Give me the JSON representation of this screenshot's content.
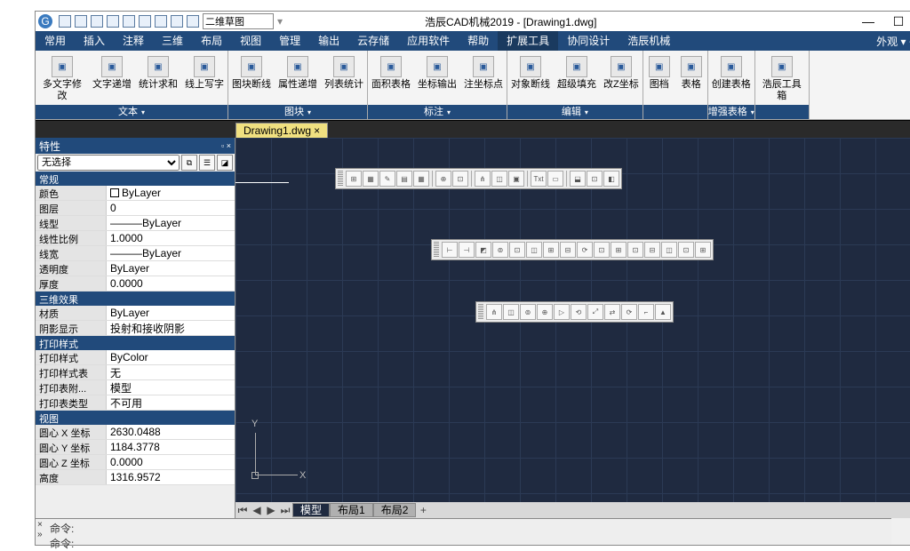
{
  "title": "浩辰CAD机械2019 - [Drawing1.dwg]",
  "quick_combo": "二维草图",
  "menu": {
    "items": [
      "常用",
      "插入",
      "注释",
      "三维",
      "布局",
      "视图",
      "管理",
      "输出",
      "云存储",
      "应用软件",
      "帮助",
      "扩展工具",
      "协同设计",
      "浩辰机械"
    ],
    "active": 11,
    "appearance": "外观 ▾"
  },
  "ribbon": {
    "groups": [
      {
        "label": "文本",
        "buttons": [
          "多文字修改",
          "文字递增",
          "统计求和",
          "线上写字"
        ]
      },
      {
        "label": "图块",
        "buttons": [
          "图块断线",
          "属性递增",
          "列表统计"
        ]
      },
      {
        "label": "标注",
        "buttons": [
          "面积表格",
          "坐标输出",
          "注坐标点"
        ]
      },
      {
        "label": "编辑",
        "buttons": [
          "对象断线",
          "超级填充",
          "改Z坐标"
        ]
      },
      {
        "label": "",
        "buttons": [
          "图档",
          "表格"
        ]
      },
      {
        "label": "增强表格",
        "buttons": [
          "创建表格"
        ]
      },
      {
        "label": "",
        "buttons": [
          "浩辰工具箱"
        ]
      }
    ]
  },
  "doc_tab": "Drawing1.dwg",
  "props": {
    "title": "特性",
    "selection": "无选择",
    "groups": [
      {
        "name": "常规",
        "rows": [
          {
            "k": "颜色",
            "v": "ByLayer",
            "swatch": true
          },
          {
            "k": "图层",
            "v": "0"
          },
          {
            "k": "线型",
            "v": "———ByLayer"
          },
          {
            "k": "线性比例",
            "v": "1.0000"
          },
          {
            "k": "线宽",
            "v": "———ByLayer"
          },
          {
            "k": "透明度",
            "v": "ByLayer"
          },
          {
            "k": "厚度",
            "v": "0.0000"
          }
        ]
      },
      {
        "name": "三维效果",
        "rows": [
          {
            "k": "材质",
            "v": "ByLayer"
          },
          {
            "k": "阴影显示",
            "v": "投射和接收阴影"
          }
        ]
      },
      {
        "name": "打印样式",
        "rows": [
          {
            "k": "打印样式",
            "v": "ByColor"
          },
          {
            "k": "打印样式表",
            "v": "无"
          },
          {
            "k": "打印表附...",
            "v": "模型"
          },
          {
            "k": "打印表类型",
            "v": "不可用"
          }
        ]
      },
      {
        "name": "视图",
        "rows": [
          {
            "k": "圆心 X 坐标",
            "v": "2630.0488"
          },
          {
            "k": "圆心 Y 坐标",
            "v": "1184.3778"
          },
          {
            "k": "圆心 Z 坐标",
            "v": "0.0000"
          },
          {
            "k": "高度",
            "v": "1316.9572"
          }
        ]
      }
    ]
  },
  "layout_tabs": {
    "items": [
      "模型",
      "布局1",
      "布局2"
    ],
    "active": 0
  },
  "ucs": {
    "y": "Y",
    "x": "X"
  },
  "cmd": {
    "line1": "命令:",
    "line2": "命令:"
  }
}
